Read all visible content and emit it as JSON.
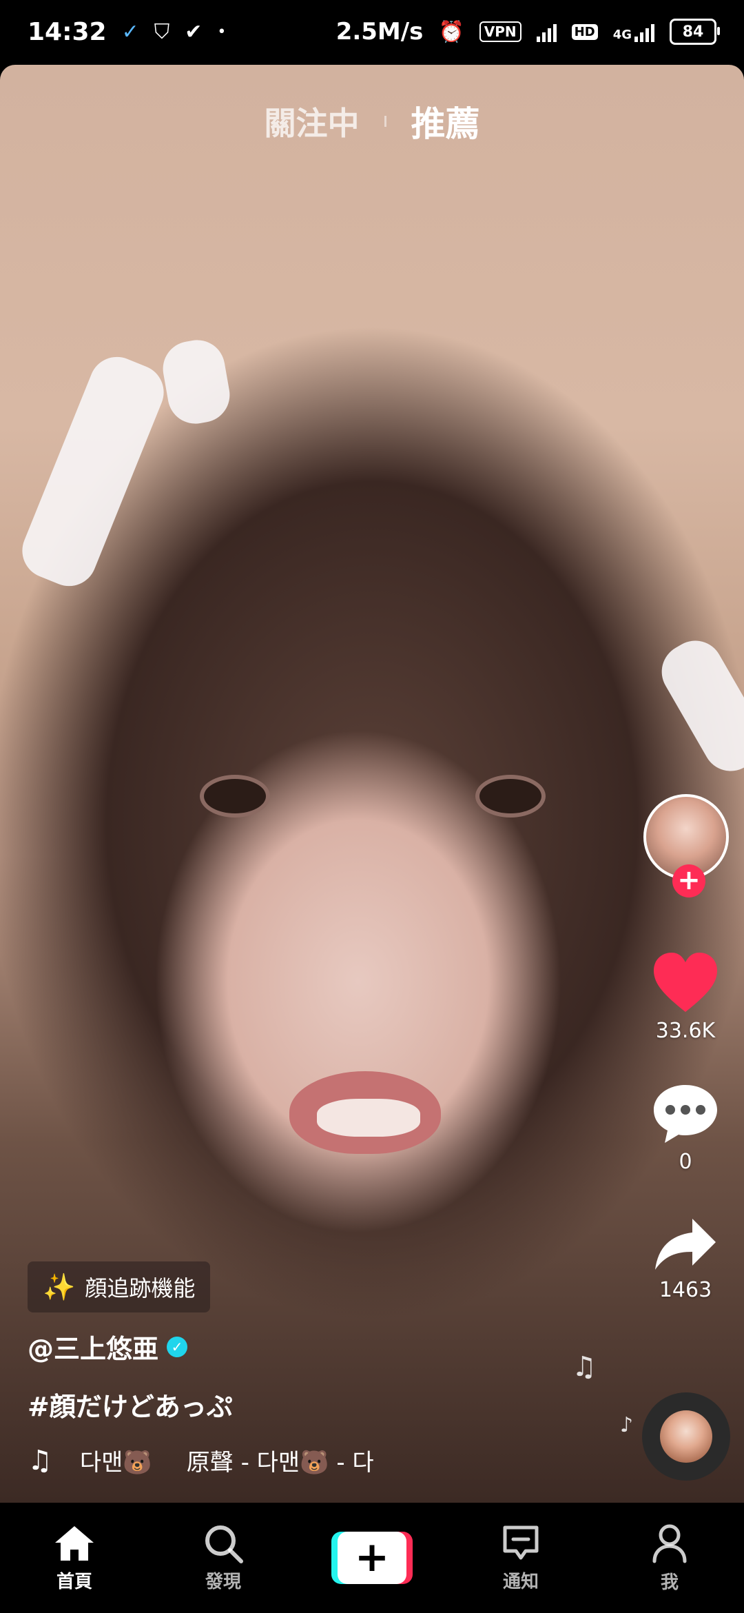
{
  "status_bar": {
    "time": "14:32",
    "speed": "2.5M/s",
    "vpn": "VPN",
    "hd": "HD",
    "network": "4G",
    "battery": "84"
  },
  "top_tabs": {
    "following": "關注中",
    "recommended": "推薦"
  },
  "actions": {
    "likes": "33.6K",
    "comments": "0",
    "shares": "1463"
  },
  "video_info": {
    "effect_label": "顔追跡機能",
    "username": "@三上悠亜",
    "caption": "#顔だけどあっぷ",
    "music_prefix": "다맨🐻",
    "music_title": "原聲 - 다맨🐻 - 다"
  },
  "nav": {
    "home": "首頁",
    "discover": "發現",
    "inbox": "通知",
    "me": "我"
  },
  "colors": {
    "like": "#fe2c55",
    "follow": "#fe2c55",
    "create_cyan": "#25f4ee",
    "create_pink": "#fe2c55",
    "verified": "#20d5ec"
  }
}
